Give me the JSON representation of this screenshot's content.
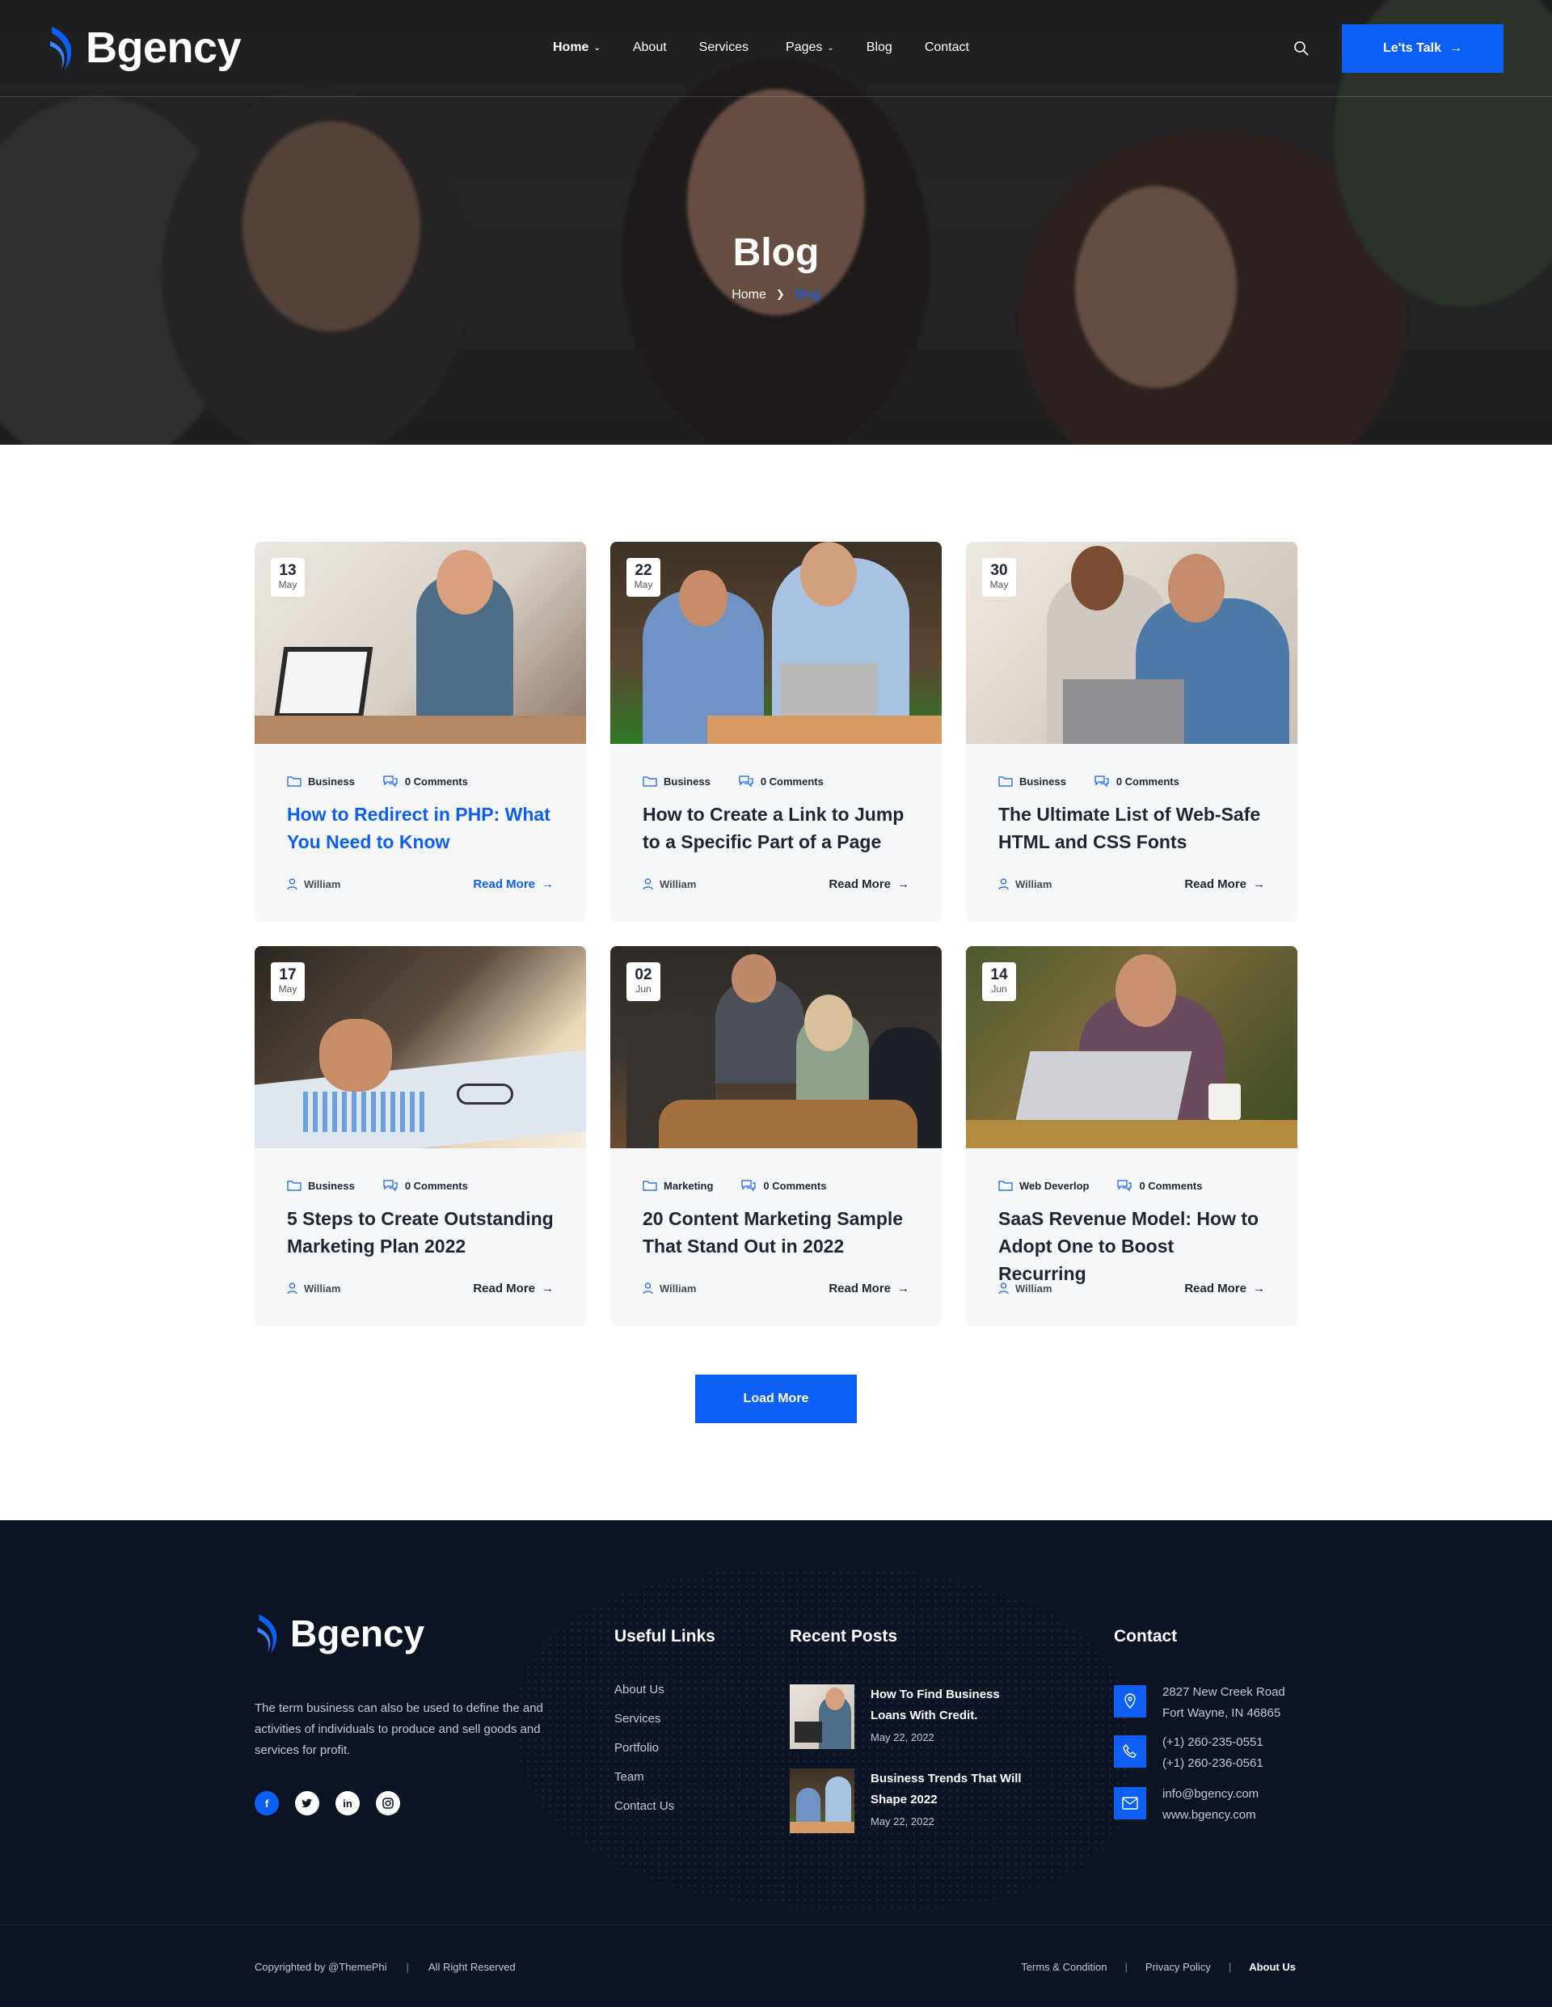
{
  "brand": {
    "name": "Bgency",
    "accent": "#0d5ef4",
    "footer_bg": "#0c1322"
  },
  "nav": {
    "items": [
      {
        "label": "Home",
        "dropdown": true,
        "active": true
      },
      {
        "label": "About",
        "dropdown": false
      },
      {
        "label": "Services",
        "dropdown": false
      },
      {
        "label": "Pages",
        "dropdown": true
      },
      {
        "label": "Blog",
        "dropdown": false
      },
      {
        "label": "Contact",
        "dropdown": false
      }
    ],
    "search_icon": "search-icon",
    "cta_label": "Le'ts Talk"
  },
  "hero": {
    "title": "Blog",
    "breadcrumb_home": "Home",
    "breadcrumb_current": "Blog"
  },
  "posts": [
    {
      "day": "13",
      "month": "May",
      "category": "Business",
      "comments": "0 Comments",
      "title": "How to Redirect in PHP: What You Need to Know",
      "author": "William",
      "read_more": "Read More"
    },
    {
      "day": "22",
      "month": "May",
      "category": "Business",
      "comments": "0 Comments",
      "title": "How to Create a Link to Jump to a Specific Part of a Page",
      "author": "William",
      "read_more": "Read More"
    },
    {
      "day": "30",
      "month": "May",
      "category": "Business",
      "comments": "0 Comments",
      "title": "The Ultimate List of Web-Safe HTML and CSS Fonts",
      "author": "William",
      "read_more": "Read More"
    },
    {
      "day": "17",
      "month": "May",
      "category": "Business",
      "comments": "0 Comments",
      "title": "5 Steps to Create Outstanding Marketing Plan 2022",
      "author": "William",
      "read_more": "Read More"
    },
    {
      "day": "02",
      "month": "Jun",
      "category": "Marketing",
      "comments": "0 Comments",
      "title": "20 Content Marketing Sample That Stand Out in 2022",
      "author": "William",
      "read_more": "Read More"
    },
    {
      "day": "14",
      "month": "Jun",
      "category": "Web Deverlop",
      "comments": "0 Comments",
      "title": "SaaS Revenue Model: How to Adopt One to Boost Recurring",
      "author": "William",
      "read_more": "Read More"
    }
  ],
  "load_more": "Load More",
  "footer": {
    "description": "The term business can also be used to define the and activities of individuals to produce and sell goods and services for profit.",
    "socials": [
      "facebook-icon",
      "twitter-icon",
      "linkedin-icon",
      "instagram-icon"
    ],
    "useful_links_title": "Useful Links",
    "useful_links": [
      "About Us",
      "Services",
      "Portfolio",
      "Team",
      "Contact Us"
    ],
    "recent_posts_title": "Recent Posts",
    "recent_posts": [
      {
        "title": "How To Find Business Loans With Credit.",
        "date": "May 22, 2022"
      },
      {
        "title": "Business Trends That Will Shape 2022",
        "date": "May 22, 2022"
      }
    ],
    "contact_title": "Contact",
    "contact": {
      "address_1": "2827 New Creek Road",
      "address_2": "Fort Wayne, IN 46865",
      "phone_1": "(+1) 260-235-0551",
      "phone_2": "(+1) 260-236-0561",
      "email": "info@bgency.com",
      "website": "www.bgency.com"
    },
    "copyright": "Copyrighted by @ThemePhi",
    "rights": "All Right Reserved",
    "legal_links": [
      "Terms & Condition",
      "Privacy Policy",
      "About Us"
    ]
  }
}
